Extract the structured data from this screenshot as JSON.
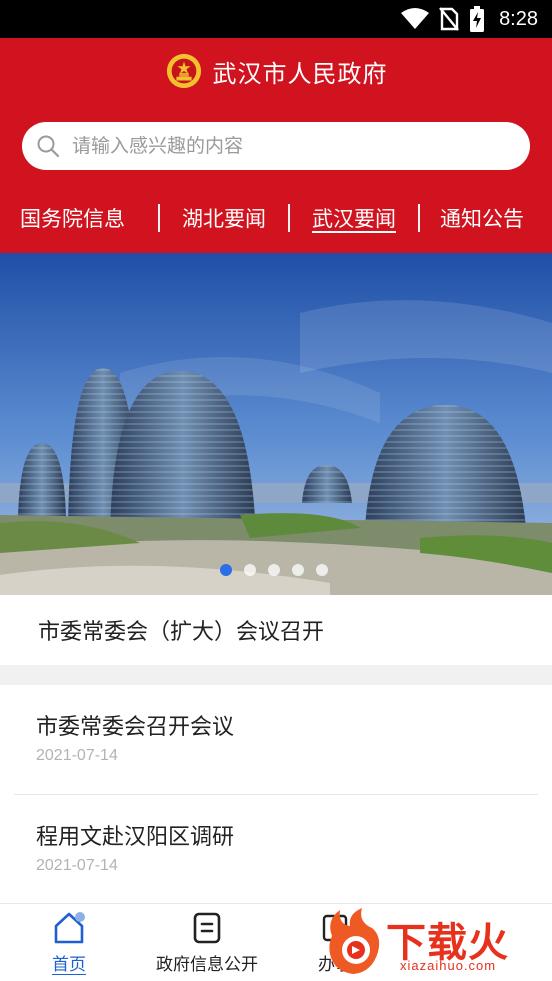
{
  "status_bar": {
    "time": "8:28",
    "icons": [
      "wifi-icon",
      "no-sim-icon",
      "battery-charging-icon"
    ]
  },
  "header": {
    "title": "武汉市人民政府",
    "emblem_icon": "national-emblem-icon",
    "background_color": "#d0131e"
  },
  "search": {
    "placeholder": "请输入感兴趣的内容",
    "value": "",
    "icon": "search-icon"
  },
  "nav_tabs": [
    {
      "label": "国务院信息",
      "active": false
    },
    {
      "label": "湖北要闻",
      "active": false
    },
    {
      "label": "武汉要闻",
      "active": true
    },
    {
      "label": "通知公告",
      "active": false
    }
  ],
  "banner": {
    "caption": "市委常委会（扩大）会议召开",
    "slide_count": 5,
    "active_slide": 1
  },
  "news": [
    {
      "title": "市委常委会召开会议",
      "date": "2021-07-14"
    },
    {
      "title": "程用文赴汉阳区调研",
      "date": "2021-07-14"
    }
  ],
  "tabbar": {
    "tabs": [
      {
        "label": "首页",
        "icon": "home-icon",
        "active": true
      },
      {
        "label": "政府信息公开",
        "icon": "document-icon",
        "active": false
      },
      {
        "label": "办事",
        "icon": "service-icon",
        "active": false
      }
    ]
  },
  "watermark": {
    "brand": "下载火",
    "url": "xiazaihuo.com"
  },
  "colors": {
    "accent": "#d0131e",
    "active_tab": "#1f5fd1",
    "active_dot": "#2b6de6"
  }
}
